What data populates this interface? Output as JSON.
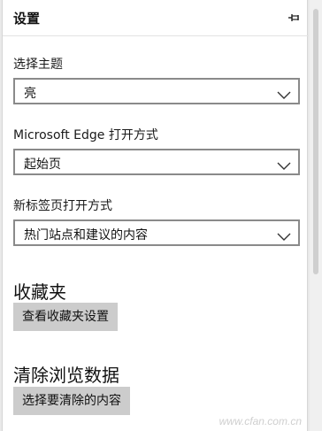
{
  "panel": {
    "title": "设置",
    "pin_icon": "pin-icon"
  },
  "theme": {
    "label": "选择主题",
    "value": "亮"
  },
  "open_with": {
    "label": "Microsoft Edge 打开方式",
    "value": "起始页"
  },
  "new_tab": {
    "label": "新标签页打开方式",
    "value": "热门站点和建议的内容"
  },
  "favorites": {
    "heading": "收藏夹",
    "button": "查看收藏夹设置"
  },
  "clear_data": {
    "heading": "清除浏览数据",
    "button": "选择要清除的内容"
  },
  "watermark": "www.cfan.com.cn",
  "colors": {
    "panel_bg": "#ffffff",
    "button_bg": "#cccccc",
    "select_border": "#8a8a8a"
  }
}
